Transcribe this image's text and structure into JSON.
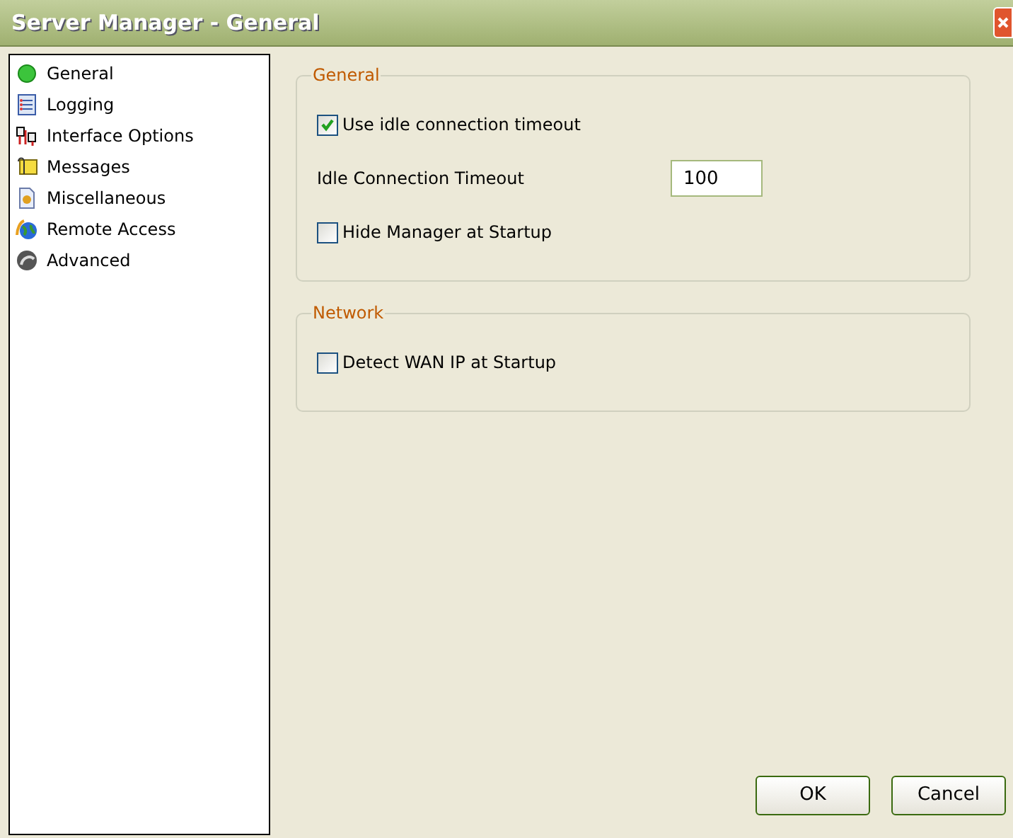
{
  "window": {
    "title": "Server Manager - General"
  },
  "sidebar": {
    "items": [
      {
        "label": "General"
      },
      {
        "label": "Logging"
      },
      {
        "label": "Interface Options"
      },
      {
        "label": "Messages"
      },
      {
        "label": "Miscellaneous"
      },
      {
        "label": "Remote Access"
      },
      {
        "label": "Advanced"
      }
    ]
  },
  "groups": [
    {
      "title": "General",
      "items": [
        {
          "kind": "checkbox",
          "label": "Use idle connection timeout",
          "checked": true
        },
        {
          "kind": "field",
          "label": "Idle Connection Timeout",
          "value": "100"
        },
        {
          "kind": "checkbox",
          "label": "Hide Manager at Startup",
          "checked": false
        }
      ]
    },
    {
      "title": "Network",
      "items": [
        {
          "kind": "checkbox",
          "label": "Detect WAN IP at Startup",
          "checked": false
        }
      ]
    }
  ],
  "buttons": [
    "OK",
    "Cancel"
  ]
}
